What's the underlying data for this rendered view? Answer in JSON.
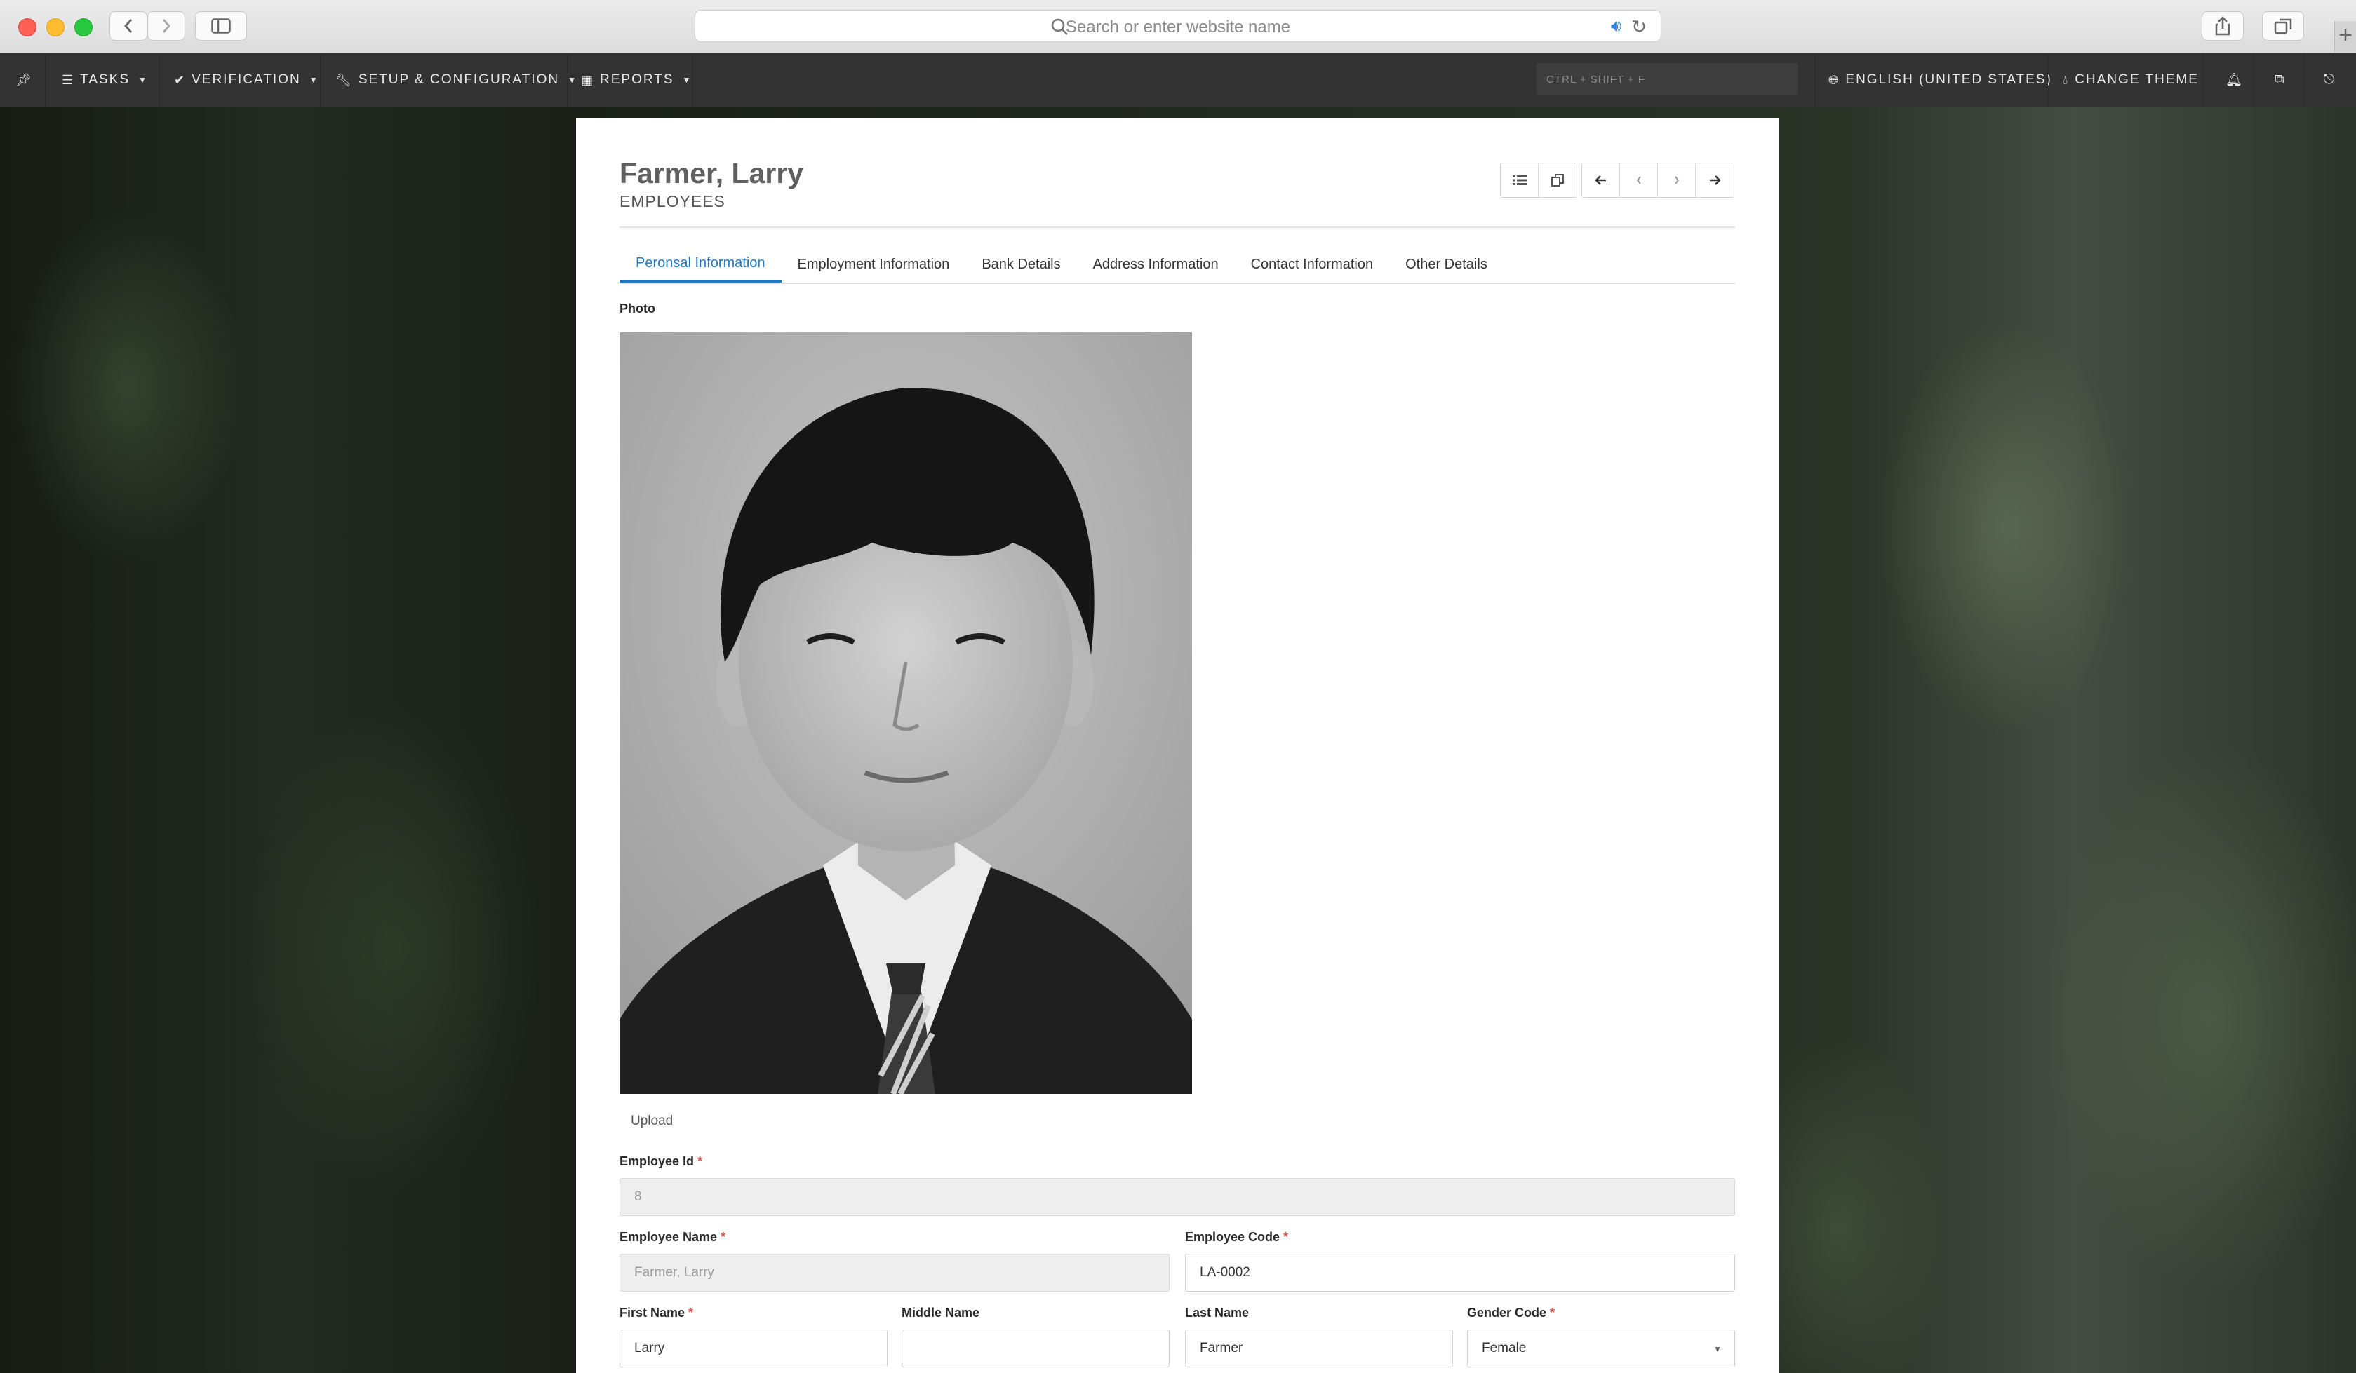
{
  "browser": {
    "address_placeholder": "Search or enter website name"
  },
  "navbar": {
    "tasks": "TASKS",
    "verification": "VERIFICATION",
    "setup": "SETUP & CONFIGURATION",
    "reports": "REPORTS",
    "search_hint": "CTRL + SHIFT + F",
    "language": "ENGLISH (UNITED STATES)",
    "theme": "CHANGE THEME"
  },
  "record": {
    "title": "Farmer, Larry",
    "module": "EMPLOYEES"
  },
  "tabs": [
    {
      "label": "Peronsal Information",
      "active": true
    },
    {
      "label": "Employment Information",
      "active": false
    },
    {
      "label": "Bank Details",
      "active": false
    },
    {
      "label": "Address Information",
      "active": false
    },
    {
      "label": "Contact Information",
      "active": false
    },
    {
      "label": "Other Details",
      "active": false
    }
  ],
  "form": {
    "photo_label": "Photo",
    "upload_label": "Upload",
    "employee_id": {
      "label": "Employee Id",
      "value": "8"
    },
    "employee_name": {
      "label": "Employee Name",
      "value": "Farmer, Larry"
    },
    "employee_code": {
      "label": "Employee Code",
      "value": "LA-0002"
    },
    "first_name": {
      "label": "First Name",
      "value": "Larry"
    },
    "middle_name": {
      "label": "Middle Name",
      "value": ""
    },
    "last_name": {
      "label": "Last Name",
      "value": "Farmer"
    },
    "gender_code": {
      "label": "Gender Code",
      "value": "Female"
    },
    "required_marker": "*"
  },
  "icons": {
    "pin": "pin-icon",
    "list": "list-icon",
    "copy": "copy-icon",
    "first": "first-record-icon",
    "prev": "previous-record-icon",
    "next": "next-record-icon",
    "last": "last-record-icon"
  },
  "colors": {
    "navbar": "#333333",
    "accent": "#1f78c1",
    "required": "#d9534f"
  }
}
